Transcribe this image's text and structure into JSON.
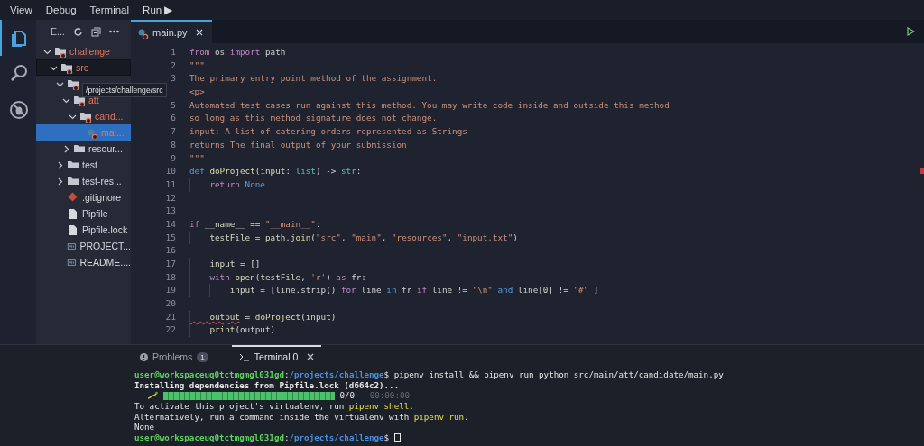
{
  "menu": [
    "View",
    "Debug",
    "Terminal",
    "Run ▶"
  ],
  "activity_bar": [
    {
      "kind": "files",
      "selected": true
    },
    {
      "kind": "search",
      "selected": false
    },
    {
      "kind": "debug",
      "selected": false
    }
  ],
  "explorer": {
    "title": "E...",
    "tree": [
      {
        "label": "challenge",
        "kind": "folder",
        "expanded": true,
        "error": true,
        "selected": false,
        "focused": false,
        "children": [
          {
            "label": "src",
            "kind": "folder",
            "expanded": true,
            "error": true,
            "selected": false,
            "focused": true,
            "children": [
              {
                "kind": "folder",
                "expanded": true,
                "error": true,
                "selected": false,
                "focused": false,
                "children": [
                  {
                    "label": "att",
                    "kind": "folder",
                    "expanded": true,
                    "error": true,
                    "selected": false,
                    "focused": false,
                    "children": [
                      {
                        "label": "cand...",
                        "kind": "folder",
                        "expanded": true,
                        "error": true,
                        "selected": false,
                        "focused": false,
                        "children": [
                          {
                            "label": "mai...",
                            "kind": "python",
                            "error": true,
                            "selected": true,
                            "focused": false
                          }
                        ]
                      }
                    ]
                  },
                  {
                    "label": "resour...",
                    "kind": "folder",
                    "expanded": false,
                    "error": false,
                    "selected": false,
                    "focused": false
                  }
                ]
              },
              {
                "label": "test",
                "kind": "folder",
                "expanded": false,
                "error": false,
                "selected": false,
                "focused": false
              },
              {
                "label": "test-res...",
                "kind": "folder",
                "expanded": false,
                "error": false,
                "selected": false,
                "focused": false
              },
              {
                "label": ".gitignore",
                "kind": "git",
                "error": false,
                "selected": false,
                "focused": false
              },
              {
                "label": "Pipfile",
                "kind": "file",
                "error": false,
                "selected": false,
                "focused": false
              },
              {
                "label": "Pipfile.lock",
                "kind": "file",
                "error": false,
                "selected": false,
                "focused": false
              },
              {
                "label": "PROJECT...",
                "kind": "markdown",
                "error": false,
                "selected": false,
                "focused": false
              },
              {
                "label": "README....",
                "kind": "markdown",
                "error": false,
                "selected": false,
                "focused": false
              }
            ]
          }
        ]
      }
    ]
  },
  "tooltip": "/projects/challenge/src",
  "editor": {
    "tabs": [
      {
        "label": "main.py",
        "selected": true,
        "error": true
      }
    ],
    "lines": [
      {
        "number": "1",
        "tokens": [
          {
            "text": "from",
            "kind": "keyword"
          },
          {
            "text": " os ",
            "kind": "plain"
          },
          {
            "text": "import",
            "kind": "keyword"
          },
          {
            "text": " path",
            "kind": "plain"
          }
        ]
      },
      {
        "number": "2",
        "tokens": [
          {
            "text": "\"\"\"",
            "kind": "string"
          }
        ]
      },
      {
        "number": "3",
        "tokens": [
          {
            "text": "The primary entry point method of the assignment.",
            "kind": "string"
          }
        ]
      },
      {
        "tokens": [
          {
            "text": "<p>",
            "kind": "string"
          }
        ]
      },
      {
        "number": "5",
        "tokens": [
          {
            "text": "Automated test cases run against this method. You may write code inside and outside this method",
            "kind": "string"
          }
        ]
      },
      {
        "number": "6",
        "tokens": [
          {
            "text": "so long as this method signature does not change.",
            "kind": "string"
          }
        ]
      },
      {
        "number": "7",
        "tokens": [
          {
            "text": "input: A list of catering orders represented as Strings",
            "kind": "string"
          }
        ]
      },
      {
        "number": "8",
        "tokens": [
          {
            "text": "returns The final output of your submission",
            "kind": "string"
          }
        ]
      },
      {
        "number": "9",
        "tokens": [
          {
            "text": "\"\"\"",
            "kind": "string"
          }
        ]
      },
      {
        "number": "10",
        "tokens": [
          {
            "text": "def ",
            "kind": "constant"
          },
          {
            "text": "doProject",
            "kind": "function"
          },
          {
            "text": "(",
            "kind": "plain"
          },
          {
            "text": "input",
            "kind": "variable"
          },
          {
            "text": ": ",
            "kind": "plain"
          },
          {
            "text": "list",
            "kind": "builtin"
          },
          {
            "text": ") -> ",
            "kind": "plain"
          },
          {
            "text": "str",
            "kind": "builtin"
          },
          {
            "text": ":",
            "kind": "plain"
          }
        ]
      },
      {
        "number": "11",
        "tokens": [
          {
            "text": "    return ",
            "kind": "keyword"
          },
          {
            "text": "None",
            "kind": "constant"
          }
        ]
      },
      {
        "number": "12"
      },
      {
        "number": "13"
      },
      {
        "number": "14",
        "tokens": [
          {
            "text": "if ",
            "kind": "keyword"
          },
          {
            "text": "__name__",
            "kind": "variable"
          },
          {
            "text": " == ",
            "kind": "plain"
          },
          {
            "text": "\"__main__\"",
            "kind": "string"
          },
          {
            "text": ":",
            "kind": "plain"
          }
        ]
      },
      {
        "number": "15",
        "tokens": [
          {
            "text": "    testFile = path.",
            "kind": "variable"
          },
          {
            "text": "join",
            "kind": "function"
          },
          {
            "text": "(",
            "kind": "plain"
          },
          {
            "text": "\"src\"",
            "kind": "string"
          },
          {
            "text": ", ",
            "kind": "plain"
          },
          {
            "text": "\"main\"",
            "kind": "string"
          },
          {
            "text": ", ",
            "kind": "plain"
          },
          {
            "text": "\"resources\"",
            "kind": "string"
          },
          {
            "text": ", ",
            "kind": "plain"
          },
          {
            "text": "\"input.txt\"",
            "kind": "string"
          },
          {
            "text": ")",
            "kind": "plain"
          }
        ]
      },
      {
        "number": "16"
      },
      {
        "number": "17",
        "tokens": [
          {
            "text": "    input",
            "kind": "variable"
          },
          {
            "text": " = []",
            "kind": "plain"
          }
        ]
      },
      {
        "number": "18",
        "tokens": [
          {
            "text": "    with ",
            "kind": "keyword"
          },
          {
            "text": "open",
            "kind": "function"
          },
          {
            "text": "(",
            "kind": "plain"
          },
          {
            "text": "testFile",
            "kind": "variable"
          },
          {
            "text": ", ",
            "kind": "plain"
          },
          {
            "text": "'r'",
            "kind": "string"
          },
          {
            "text": ") ",
            "kind": "plain"
          },
          {
            "text": "as",
            "kind": "keyword"
          },
          {
            "text": " fr:",
            "kind": "plain"
          }
        ]
      },
      {
        "number": "19",
        "tokens": [
          {
            "text": "        input",
            "kind": "variable"
          },
          {
            "text": " = [line.strip() ",
            "kind": "plain"
          },
          {
            "text": "for",
            "kind": "keyword"
          },
          {
            "text": " line ",
            "kind": "plain"
          },
          {
            "text": "in",
            "kind": "constant"
          },
          {
            "text": " fr ",
            "kind": "plain"
          },
          {
            "text": "if",
            "kind": "keyword"
          },
          {
            "text": " line != ",
            "kind": "plain"
          },
          {
            "text": "\"\\n\"",
            "kind": "string"
          },
          {
            "text": " and",
            "kind": "constant"
          },
          {
            "text": " line[0] != ",
            "kind": "plain"
          },
          {
            "text": "\"#\"",
            "kind": "string"
          },
          {
            "text": " ]",
            "kind": "plain"
          }
        ]
      },
      {
        "number": "20"
      },
      {
        "number": "21",
        "tokens": [
          {
            "text": "    output",
            "kind": "warning"
          },
          {
            "text": " = ",
            "kind": "plain"
          },
          {
            "text": "doProject",
            "kind": "function"
          },
          {
            "text": "(",
            "kind": "plain"
          },
          {
            "text": "input",
            "kind": "variable"
          },
          {
            "text": ")",
            "kind": "plain"
          }
        ]
      },
      {
        "number": "22",
        "tokens": [
          {
            "text": "    print",
            "kind": "function"
          },
          {
            "text": "(output)",
            "kind": "plain"
          }
        ]
      }
    ]
  },
  "panel": {
    "tabs": [
      {
        "label": "Problems",
        "selected": false,
        "badge": "1",
        "kind": "problems"
      },
      {
        "label": "Terminal 0",
        "selected": true,
        "kind": "terminal"
      }
    ],
    "terminal": [
      [
        {
          "text": "user@workspaceuq0tctmgmgl031gd",
          "kind": "user"
        },
        {
          "text": ":",
          "kind": "plain"
        },
        {
          "text": "/projects/challenge",
          "kind": "path"
        },
        {
          "text": "$ pipenv install && pipenv run python src/main/att/candidate/main.py",
          "kind": "plain"
        }
      ],
      [
        {
          "text": "Installing dependencies from Pipfile.lock (d664c2)...",
          "kind": "bold"
        }
      ],
      [
        {
          "kind": "progress",
          "level": 1
        },
        {
          "text": " 0/0 – ",
          "kind": "plain"
        },
        {
          "text": "00:00:00",
          "kind": "dim"
        }
      ],
      [
        {
          "text": "To activate this project's virtualenv, run ",
          "kind": "plain"
        },
        {
          "text": "pipenv shell",
          "kind": "highlight"
        },
        {
          "text": ".",
          "kind": "plain"
        }
      ],
      [
        {
          "text": "Alternatively, run a command inside the virtualenv with ",
          "kind": "plain"
        },
        {
          "text": "pipenv run",
          "kind": "highlight"
        },
        {
          "text": ".",
          "kind": "plain"
        }
      ],
      [
        {
          "text": "None",
          "kind": "plain"
        }
      ],
      [
        {
          "text": "user@workspaceuq0tctmgmgl031gd",
          "kind": "user"
        },
        {
          "text": ":",
          "kind": "plain"
        },
        {
          "text": "/projects/challenge",
          "kind": "path"
        },
        {
          "text": "$",
          "kind": "plain"
        },
        {
          "kind": "cursor"
        }
      ]
    ]
  }
}
